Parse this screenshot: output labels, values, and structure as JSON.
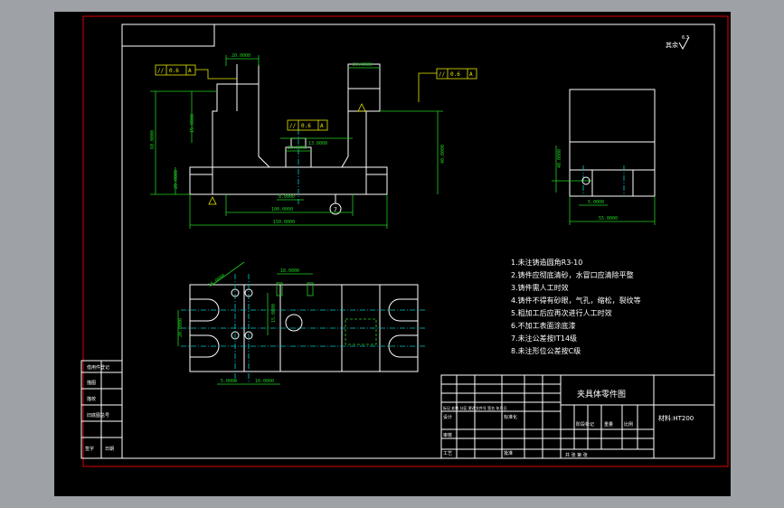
{
  "colors": {
    "background": "#000000",
    "frame": "#e00000",
    "outline": "#ffffff",
    "dimension": "#20d020",
    "centerline": "#00c8c8",
    "tolerance": "#e8e800"
  },
  "roughness_symbol": {
    "value": "6.3",
    "prefix": "其余"
  },
  "dims_front": {
    "top_left_width": "20.0000",
    "top_right_width": "20.0000",
    "height_total": "60.0000",
    "height_15": "15.0000",
    "height_13": "13.0000",
    "height_40": "40.0000",
    "height_20_base": "20.0000",
    "width_100": "100.0000",
    "width_150": "150.0000",
    "width_8": "8.0000",
    "width_20_slot": "20.0000",
    "small_left": "14",
    "parallel_sym": "//",
    "parallel_val": "0.6",
    "datum_letter": "A"
  },
  "dims_side": {
    "height_40": "40.0000",
    "width_5": "5.0000",
    "width_55": "55.0000"
  },
  "dims_plan": {
    "diag": "18.0000",
    "top_small": "18.0000",
    "h_20": "20.0000",
    "h_15": "15.0000",
    "bottom_5": "5.0000",
    "bottom_10": "10.0000"
  },
  "notes": [
    "1.未注铸造圆角R3-10",
    "2.铸件应彻底清砂，水冒口应清除平整",
    "3.铸件需人工时效",
    "4.铸件不得有砂眼，气孔，缩松，裂纹等",
    "5.粗加工后应再次进行人工时效",
    "6.不加工表面涂底漆",
    "7.未注公差按IT14级",
    "8.未注形位公差按C级"
  ],
  "title_block": {
    "title": "夹具体零件图",
    "material": "材料:HT200",
    "row_marks": "标记 处数 分区 更改文件号 签名 年月日",
    "row_design": "设计",
    "row_standard": "标准化",
    "row_audit": "审核",
    "row_process": "工艺",
    "row_approve": "批准",
    "stage_label": "阶段标记",
    "weight_label": "重量",
    "scale_label": "比例",
    "sheet_info": "共 张 第 张"
  },
  "left_strip": [
    "借用件登记",
    "描图",
    "描校",
    "旧底图总号",
    "签字",
    "日期"
  ]
}
